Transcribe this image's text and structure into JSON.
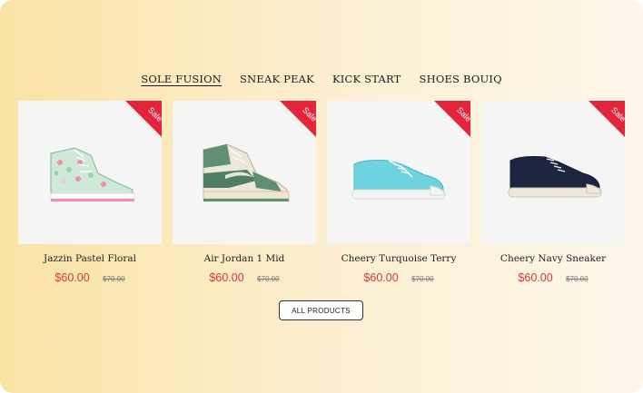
{
  "tabs": [
    {
      "label": "SOLE FUSION",
      "active": true
    },
    {
      "label": "SNEAK PEAK",
      "active": false
    },
    {
      "label": "KICK START",
      "active": false
    },
    {
      "label": "SHOES BOUIQ",
      "active": false
    }
  ],
  "products": [
    {
      "name": "Jazzin Pastel Floral",
      "price": "$60.00",
      "was": "$70.00",
      "badge": "Sale",
      "image_icon": "floral-high-top-sneaker-icon"
    },
    {
      "name": "Air Jordan 1 Mid",
      "price": "$60.00",
      "was": "$70.00",
      "badge": "Sale",
      "image_icon": "green-high-top-sneaker-icon"
    },
    {
      "name": "Cheery Turquoise Terry",
      "price": "$60.00",
      "was": "$70.00",
      "badge": "Sale",
      "image_icon": "turquoise-low-top-sneaker-icon"
    },
    {
      "name": "Cheery Navy Sneaker",
      "price": "$60.00",
      "was": "$70.00",
      "badge": "Sale",
      "image_icon": "navy-low-top-sneaker-icon"
    }
  ],
  "all_products_label": "ALL PRODUCTS",
  "colors": {
    "sale": "#e4243b",
    "price": "#d33a3a",
    "bg_left": "#fbe3a6",
    "bg_right": "#fdf7ea"
  }
}
